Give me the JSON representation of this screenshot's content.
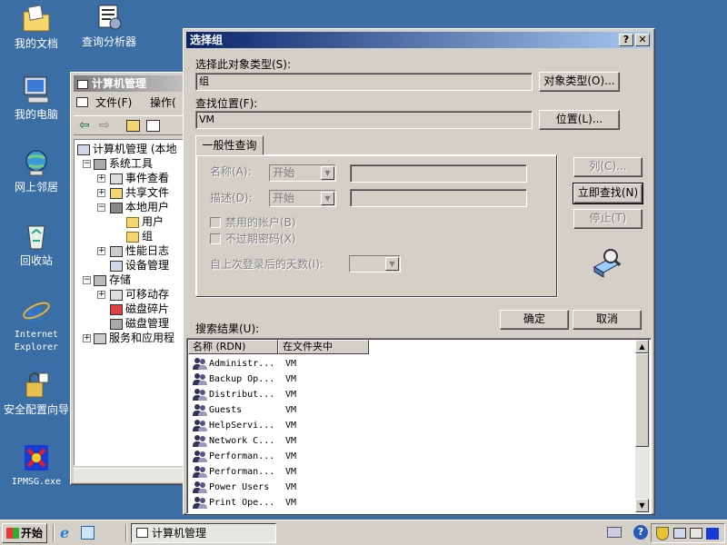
{
  "desktop": {
    "icons": [
      {
        "label": "我的文档"
      },
      {
        "label": "查询分析器"
      },
      {
        "label": "我的电脑"
      },
      {
        "label": "网上邻居"
      },
      {
        "label": "回收站"
      },
      {
        "label": "Internet\nExplorer"
      },
      {
        "label": "安全配置向导"
      },
      {
        "label": "IPMSG.exe"
      }
    ]
  },
  "mmc": {
    "title": "计算机管理",
    "menu": {
      "file": "文件(F)",
      "action": "操作("
    },
    "tree": [
      {
        "label": "计算机管理 (本地"
      },
      {
        "label": "系统工具"
      },
      {
        "label": "事件查看"
      },
      {
        "label": "共享文件"
      },
      {
        "label": "本地用户"
      },
      {
        "label": "用户"
      },
      {
        "label": "组"
      },
      {
        "label": "性能日志"
      },
      {
        "label": "设备管理"
      },
      {
        "label": "存储"
      },
      {
        "label": "可移动存"
      },
      {
        "label": "磁盘碎片"
      },
      {
        "label": "磁盘管理"
      },
      {
        "label": "服务和应用程"
      }
    ]
  },
  "dialog": {
    "title": "选择组",
    "help_btn": "?",
    "close_btn": "✕",
    "object_type_label": "选择此对象类型(S):",
    "object_type_value": "组",
    "object_type_button": "对象类型(O)...",
    "location_label": "查找位置(F):",
    "location_value": "VM",
    "location_button": "位置(L)...",
    "tab_general": "一般性查询",
    "name_label": "名称(A):",
    "name_combo": "开始",
    "desc_label": "描述(D):",
    "desc_combo": "开始",
    "disabled_accounts": "禁用的帐户(B)",
    "non_expiring": "不过期密码(X)",
    "days_since_login": "自上次登录后的天数(I):",
    "columns_button": "列(C)...",
    "find_now_button": "立即查找(N)",
    "stop_button": "停止(T)",
    "search_results_label": "搜索结果(U):",
    "ok_button": "确定",
    "cancel_button": "取消",
    "columns": [
      "名称 (RDN)",
      "在文件夹中"
    ],
    "rows": [
      {
        "name": "Administr...",
        "folder": "VM"
      },
      {
        "name": "Backup Op...",
        "folder": "VM"
      },
      {
        "name": "Distribut...",
        "folder": "VM"
      },
      {
        "name": "Guests",
        "folder": "VM"
      },
      {
        "name": "HelpServi...",
        "folder": "VM"
      },
      {
        "name": "Network C...",
        "folder": "VM"
      },
      {
        "name": "Performan...",
        "folder": "VM"
      },
      {
        "name": "Performan...",
        "folder": "VM"
      },
      {
        "name": "Power Users",
        "folder": "VM"
      },
      {
        "name": "Print Ope...",
        "folder": "VM"
      }
    ]
  },
  "taskbar": {
    "start": "开始",
    "task": "计算机管理"
  },
  "colors": {
    "desktop": "#3a6ea5",
    "title_active": "#0a246a",
    "face": "#d4d0c8"
  }
}
